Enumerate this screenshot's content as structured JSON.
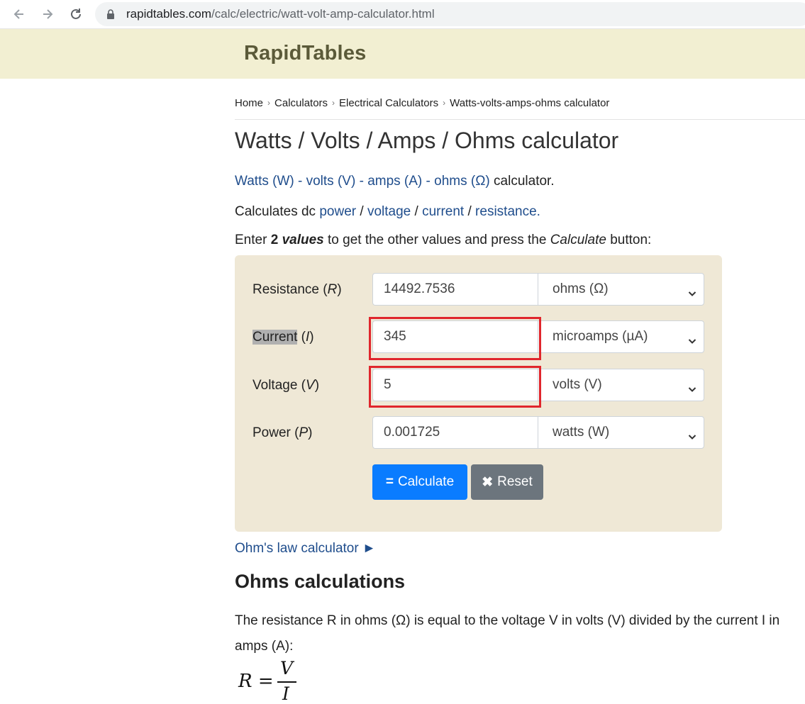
{
  "browser": {
    "url_host": "rapidtables.com",
    "url_path": "/calc/electric/watt-volt-amp-calculator.html"
  },
  "site": {
    "logo": "RapidTables"
  },
  "breadcrumb": [
    "Home",
    "Calculators",
    "Electrical Calculators",
    "Watts-volts-amps-ohms calculator"
  ],
  "page_title": "Watts / Volts / Amps / Ohms calculator",
  "intro": {
    "line1": {
      "watts": "Watts (W)",
      "sep1": " - ",
      "volts": "volts (V)",
      "sep2": " - ",
      "amps": "amps (A)",
      "sep3": " - ",
      "ohms": "ohms (Ω)",
      "tail": " calculator."
    },
    "line2": {
      "lead": "Calculates dc ",
      "power": "power",
      "s1": " / ",
      "voltage": "voltage",
      "s2": " / ",
      "current": "current",
      "s3": " / ",
      "resistance": "resistance."
    },
    "line3": {
      "lead": "Enter ",
      "count": "2",
      "values": "values",
      "mid": " to get the other values and press the ",
      "calc": "Calculate",
      "tail": " button:"
    }
  },
  "calculator": {
    "rows": [
      {
        "label": "Resistance",
        "symbol": "R",
        "value": "14492.7536",
        "unit": "ohms (Ω)"
      },
      {
        "label": "Current",
        "symbol": "I",
        "value": "345",
        "unit": "microamps (µA)"
      },
      {
        "label": "Voltage",
        "symbol": "V",
        "value": "5",
        "unit": "volts (V)"
      },
      {
        "label": "Power",
        "symbol": "P",
        "value": "0.001725",
        "unit": "watts (W)"
      }
    ],
    "calculate_label": "Calculate",
    "reset_label": "Reset"
  },
  "ohm_link": "Ohm's law calculator ►",
  "section": {
    "heading": "Ohms calculations",
    "paragraph": "The resistance R in ohms (Ω) is equal to the voltage V in volts (V) divided by the current I in amps (A):"
  },
  "formula": {
    "lhs": "R =",
    "numerator": "V",
    "denominator": "I"
  },
  "colors": {
    "header_bg": "#f2efd2",
    "panel_bg": "#efe8d6",
    "link": "#1f4d8c",
    "calc_btn": "#0a7cff",
    "reset_btn": "#6c757d",
    "highlight": "#e0262c"
  }
}
